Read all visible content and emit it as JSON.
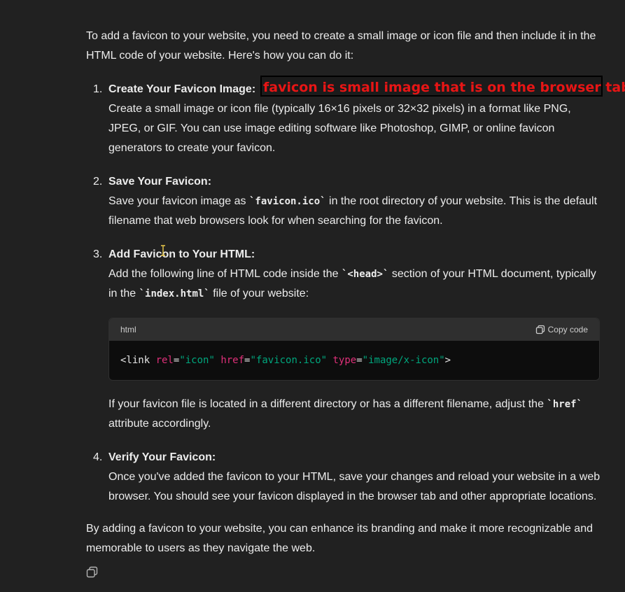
{
  "intro": "To add a favicon to your website, you need to create a small image or icon file and then include it in the HTML code of your website. Here's how you can do it:",
  "annotation": "favicon is small image that is on the browser tab",
  "steps": [
    {
      "number": "1.",
      "title": "Create Your Favicon Image:",
      "body": "Create a small image or icon file (typically 16×16 pixels or 32×32 pixels) in a format like PNG, JPEG, or GIF. You can use image editing software like Photoshop, GIMP, or online favicon generators to create your favicon."
    },
    {
      "number": "2.",
      "title": "Save Your Favicon:",
      "body_pre": "Save your favicon image as ",
      "body_code": "`favicon.ico`",
      "body_post": " in the root directory of your website. This is the default filename that web browsers look for when searching for the favicon."
    },
    {
      "number": "3.",
      "title": "Add Favicon to Your HTML:",
      "body_pre": "Add the following line of HTML code inside the ",
      "body_code1": "`<head>`",
      "body_mid": " section of your HTML document, typically in the ",
      "body_code2": "`index.html`",
      "body_post": " file of your website:",
      "after_pre": "If your favicon file is located in a different directory or has a different filename, adjust the ",
      "after_code": "`href`",
      "after_post": " attribute accordingly."
    },
    {
      "number": "4.",
      "title": "Verify Your Favicon:",
      "body": "Once you've added the favicon to your HTML, save your changes and reload your website in a web browser. You should see your favicon displayed in the browser tab and other appropriate locations."
    }
  ],
  "codeblock": {
    "language": "html",
    "copy_label": "Copy code",
    "tokens": {
      "open": "<link ",
      "attr1": "rel",
      "eq1": "=",
      "val1": "\"icon\"",
      "sp1": " ",
      "attr2": "href",
      "eq2": "=",
      "val2": "\"favicon.ico\"",
      "sp2": " ",
      "attr3": "type",
      "eq3": "=",
      "val3": "\"image/x-icon\"",
      "close": ">"
    }
  },
  "outro": "By adding a favicon to your website, you can enhance its branding and make it more recognizable and memorable to users as they navigate the web.",
  "colors": {
    "background": "#212121",
    "annotation_text": "#e81515",
    "code_attr": "#df3079",
    "code_string": "#00a67d"
  },
  "icons": [
    "copy-icon",
    "text-cursor-icon"
  ]
}
